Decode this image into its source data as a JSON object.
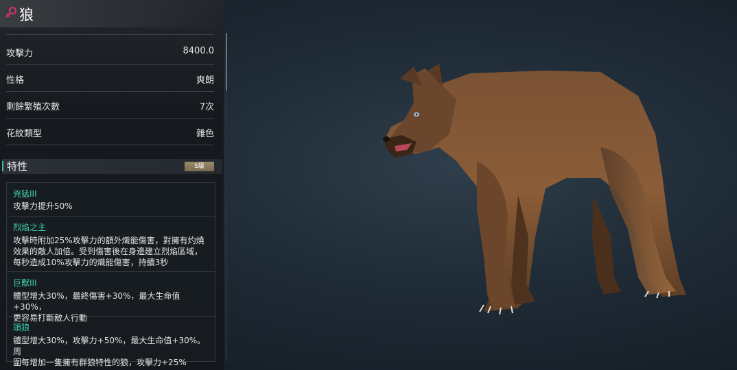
{
  "title": "狼",
  "gender_icon": "female-symbol-icon",
  "stats": [
    {
      "label": "攻擊力",
      "value": "8400.0"
    },
    {
      "label": "性格",
      "value": "爽朗"
    },
    {
      "label": "剩餘繁殖次數",
      "value": "7次"
    },
    {
      "label": "花紋類型",
      "value": "雜色"
    }
  ],
  "traits_section": {
    "title": "特性",
    "rank": "S級"
  },
  "traits": [
    {
      "name": "兇猛III",
      "desc": "攻擊力提升50%"
    },
    {
      "name": "烈焰之主",
      "desc": "攻擊時附加25%攻擊力的額外熾能傷害，對擁有灼燒\n效果的敵人加倍。受到傷害後在身邊建立烈焰區域，\n每秒造成10%攻擊力的熾能傷害，持續3秒"
    },
    {
      "name": "巨獸III",
      "desc": "體型增大30%，最終傷害+30%，最大生命值+30%，\n更容易打斷敵人行動"
    },
    {
      "name": "頭狼",
      "desc": "體型增大30%，攻擊力+50%，最大生命值+30%。周\n圍每增加一隻擁有群狼特性的狼，攻擊力+25%"
    }
  ],
  "colors": {
    "accent": "#3fd3b5",
    "gender": "#e0306e",
    "rank": "#8c7b5c"
  }
}
